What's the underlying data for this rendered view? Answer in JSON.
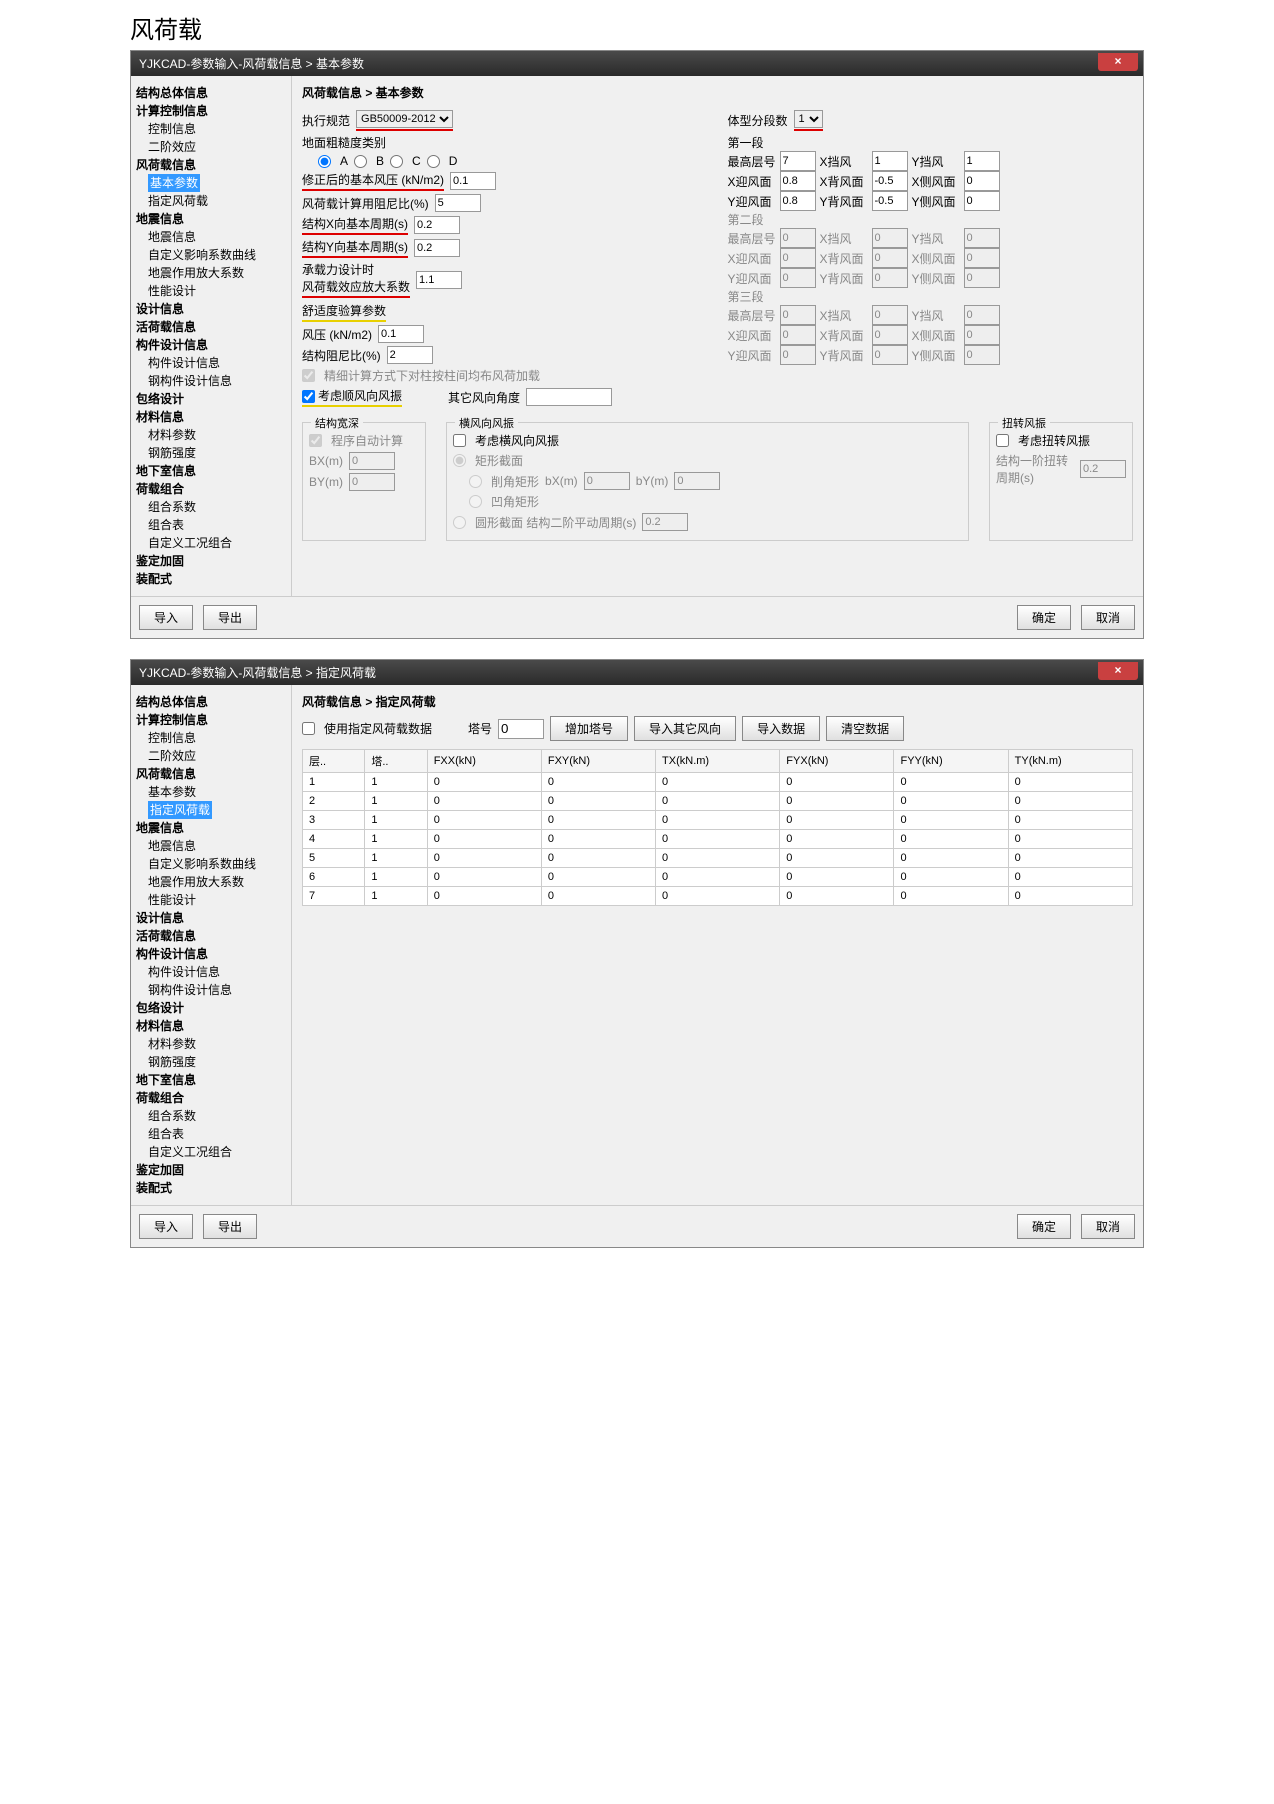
{
  "page_title": "风荷载",
  "win1": {
    "title": "YJKCAD-参数输入-风荷载信息 > 基本参数",
    "close": "×",
    "tree": {
      "items": [
        {
          "label": "结构总体信息",
          "cls": "b"
        },
        {
          "label": "计算控制信息",
          "cls": "b"
        },
        {
          "label": "控制信息",
          "cls": "i1"
        },
        {
          "label": "二阶效应",
          "cls": "i1"
        },
        {
          "label": "风荷载信息",
          "cls": "b"
        },
        {
          "label": "基本参数",
          "cls": "i1 sel"
        },
        {
          "label": "指定风荷载",
          "cls": "i1"
        },
        {
          "label": "地震信息",
          "cls": "b"
        },
        {
          "label": "地震信息",
          "cls": "i1"
        },
        {
          "label": "自定义影响系数曲线",
          "cls": "i1"
        },
        {
          "label": "地震作用放大系数",
          "cls": "i1"
        },
        {
          "label": "性能设计",
          "cls": "i1"
        },
        {
          "label": "设计信息",
          "cls": "b"
        },
        {
          "label": "活荷载信息",
          "cls": "b"
        },
        {
          "label": "构件设计信息",
          "cls": "b"
        },
        {
          "label": "构件设计信息",
          "cls": "i1"
        },
        {
          "label": "钢构件设计信息",
          "cls": "i1"
        },
        {
          "label": "包络设计",
          "cls": "b"
        },
        {
          "label": "材料信息",
          "cls": "b"
        },
        {
          "label": "材料参数",
          "cls": "i1"
        },
        {
          "label": "钢筋强度",
          "cls": "i1"
        },
        {
          "label": "地下室信息",
          "cls": "b"
        },
        {
          "label": "荷载组合",
          "cls": "b"
        },
        {
          "label": "组合系数",
          "cls": "i1"
        },
        {
          "label": "组合表",
          "cls": "i1"
        },
        {
          "label": "自定义工况组合",
          "cls": "i1"
        },
        {
          "label": "鉴定加固",
          "cls": "b"
        },
        {
          "label": "装配式",
          "cls": "b"
        }
      ]
    },
    "breadcrumb": "风荷载信息 > 基本参数",
    "exec_std_label": "执行规范",
    "exec_std_value": "GB50009-2012",
    "body_seg_label": "体型分段数",
    "body_seg_value": "1",
    "terrain_label": "地面粗糙度类别",
    "terrain_opts": [
      "A",
      "B",
      "C",
      "D"
    ],
    "basic_wp_label": "修正后的基本风压 (kN/m2)",
    "basic_wp_value": "0.1",
    "damp_label": "风荷载计算用阻尼比(%)",
    "damp_value": "5",
    "periodx_label": "结构X向基本周期(s)",
    "periodx_value": "0.2",
    "periody_label": "结构Y向基本周期(s)",
    "periody_value": "0.2",
    "bear_label": "承载力设计时\n风荷载效应放大系数",
    "bear_value": "1.1",
    "comfort_label": "舒适度验算参数",
    "comfort_wp_label": "风压 (kN/m2)",
    "comfort_wp_value": "0.1",
    "comfort_damp_label": "结构阻尼比(%)",
    "comfort_damp_value": "2",
    "precise_label": "精细计算方式下对柱按柱间均布风荷加载",
    "along_label": "考虑顺风向风振",
    "other_angle_label": "其它风向角度",
    "segs": [
      {
        "title": "第一段",
        "top_label": "最高层号",
        "top": "7",
        "xy": "X迎风面",
        "xyv": "0.8",
        "yy": "Y迎风面",
        "yyv": "0.8",
        "xd": "X挡风",
        "xdv": "1",
        "yd": "Y挡风",
        "ydv": "1",
        "xb": "X背风面",
        "xbv": "-0.5",
        "yb": "Y背风面",
        "ybv": "-0.5",
        "xs": "X侧风面",
        "xsv": "0",
        "ys": "Y侧风面",
        "ysv": "0"
      },
      {
        "title": "第二段",
        "top_label": "最高层号",
        "top": "0",
        "xy": "X迎风面",
        "xyv": "0",
        "yy": "Y迎风面",
        "yyv": "0",
        "xd": "X挡风",
        "xdv": "0",
        "yd": "Y挡风",
        "ydv": "0",
        "xb": "X背风面",
        "xbv": "0",
        "yb": "Y背风面",
        "ybv": "0",
        "xs": "X侧风面",
        "xsv": "0",
        "ys": "Y侧风面",
        "ysv": "0"
      },
      {
        "title": "第三段",
        "top_label": "最高层号",
        "top": "0",
        "xy": "X迎风面",
        "xyv": "0",
        "yy": "Y迎风面",
        "yyv": "0",
        "xd": "X挡风",
        "xdv": "0",
        "yd": "Y挡风",
        "ydv": "0",
        "xb": "X背风面",
        "xbv": "0",
        "yb": "Y背风面",
        "ybv": "0",
        "xs": "X侧风面",
        "xsv": "0",
        "ys": "Y侧风面",
        "ysv": "0"
      }
    ],
    "gb1_title": "结构宽深",
    "auto_calc": "程序自动计算",
    "bx_label": "BX(m)",
    "bx_val": "0",
    "by_label": "BY(m)",
    "by_val": "0",
    "gb2_title": "横风向风振",
    "cross_label": "考虑横风向风振",
    "rect_label": "矩形截面",
    "corner_cut": "削角矩形",
    "corner_cut_bx": "bX(m)",
    "corner_cut_bxv": "0",
    "corner_cut_by": "bY(m)",
    "corner_cut_byv": "0",
    "corner_rnd": "凹角矩形",
    "circle_label": "圆形截面  结构二阶平动周期(s)",
    "circle_val": "0.2",
    "gb3_title": "扭转风振",
    "torsion_label": "考虑扭转风振",
    "torsion_period_label": "结构一阶扭转周期(s)",
    "torsion_period_val": "0.2",
    "btn_import": "导入",
    "btn_export": "导出",
    "btn_ok": "确定",
    "btn_cancel": "取消"
  },
  "win2": {
    "title": "YJKCAD-参数输入-风荷载信息 > 指定风荷载",
    "close": "×",
    "tree": {
      "items": [
        {
          "label": "结构总体信息",
          "cls": "b"
        },
        {
          "label": "计算控制信息",
          "cls": "b"
        },
        {
          "label": "控制信息",
          "cls": "i1"
        },
        {
          "label": "二阶效应",
          "cls": "i1"
        },
        {
          "label": "风荷载信息",
          "cls": "b"
        },
        {
          "label": "基本参数",
          "cls": "i1"
        },
        {
          "label": "指定风荷载",
          "cls": "i1 sel"
        },
        {
          "label": "地震信息",
          "cls": "b"
        },
        {
          "label": "地震信息",
          "cls": "i1"
        },
        {
          "label": "自定义影响系数曲线",
          "cls": "i1"
        },
        {
          "label": "地震作用放大系数",
          "cls": "i1"
        },
        {
          "label": "性能设计",
          "cls": "i1"
        },
        {
          "label": "设计信息",
          "cls": "b"
        },
        {
          "label": "活荷载信息",
          "cls": "b"
        },
        {
          "label": "构件设计信息",
          "cls": "b"
        },
        {
          "label": "构件设计信息",
          "cls": "i1"
        },
        {
          "label": "钢构件设计信息",
          "cls": "i1"
        },
        {
          "label": "包络设计",
          "cls": "b"
        },
        {
          "label": "材料信息",
          "cls": "b"
        },
        {
          "label": "材料参数",
          "cls": "i1"
        },
        {
          "label": "钢筋强度",
          "cls": "i1"
        },
        {
          "label": "地下室信息",
          "cls": "b"
        },
        {
          "label": "荷载组合",
          "cls": "b"
        },
        {
          "label": "组合系数",
          "cls": "i1"
        },
        {
          "label": "组合表",
          "cls": "i1"
        },
        {
          "label": "自定义工况组合",
          "cls": "i1"
        },
        {
          "label": "鉴定加固",
          "cls": "b"
        },
        {
          "label": "装配式",
          "cls": "b"
        }
      ]
    },
    "breadcrumb": "风荷载信息 > 指定风荷载",
    "use_label": "使用指定风荷载数据",
    "tower_label": "塔号",
    "tower_val": "0",
    "btn_add": "增加塔号",
    "btn_imp_other": "导入其它风向",
    "btn_imp_data": "导入数据",
    "btn_clear": "清空数据",
    "headers": [
      "层..",
      "塔..",
      "FXX(kN)",
      "FXY(kN)",
      "TX(kN.m)",
      "FYX(kN)",
      "FYY(kN)",
      "TY(kN.m)"
    ],
    "rows": [
      [
        "1",
        "1",
        "0",
        "0",
        "0",
        "0",
        "0",
        "0"
      ],
      [
        "2",
        "1",
        "0",
        "0",
        "0",
        "0",
        "0",
        "0"
      ],
      [
        "3",
        "1",
        "0",
        "0",
        "0",
        "0",
        "0",
        "0"
      ],
      [
        "4",
        "1",
        "0",
        "0",
        "0",
        "0",
        "0",
        "0"
      ],
      [
        "5",
        "1",
        "0",
        "0",
        "0",
        "0",
        "0",
        "0"
      ],
      [
        "6",
        "1",
        "0",
        "0",
        "0",
        "0",
        "0",
        "0"
      ],
      [
        "7",
        "1",
        "0",
        "0",
        "0",
        "0",
        "0",
        "0"
      ]
    ],
    "btn_import": "导入",
    "btn_export": "导出",
    "btn_ok": "确定",
    "btn_cancel": "取消"
  }
}
